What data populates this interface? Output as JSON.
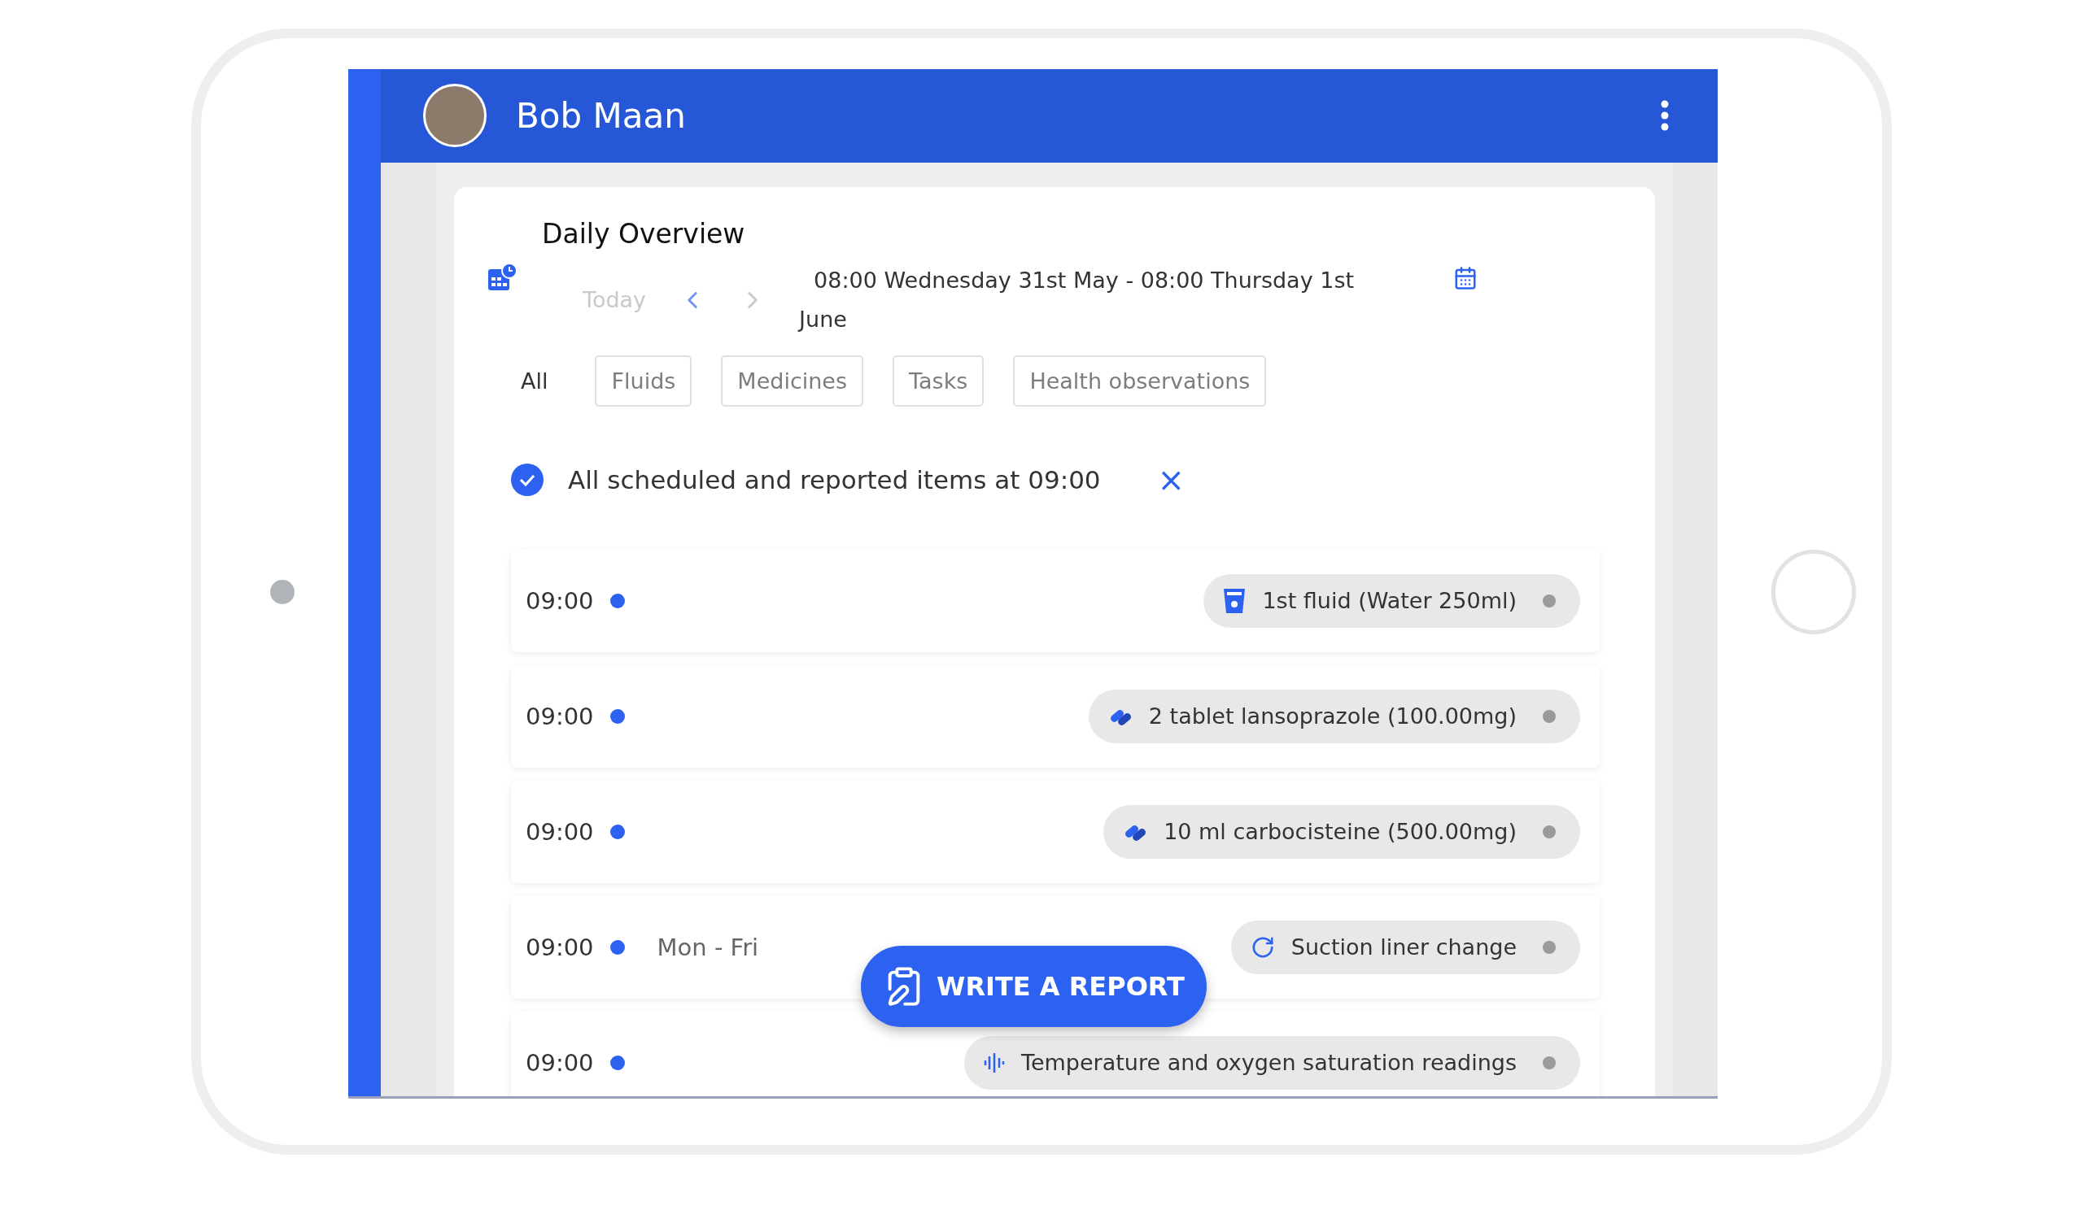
{
  "header": {
    "name": "Bob Maan"
  },
  "overview": {
    "title": "Daily Overview",
    "today": "Today",
    "range": "08:00 Wednesday 31st May - 08:00 Thursday 1st June"
  },
  "filters": [
    {
      "label": "All",
      "selected": true
    },
    {
      "label": "Fluids",
      "selected": false
    },
    {
      "label": "Medicines",
      "selected": false
    },
    {
      "label": "Tasks",
      "selected": false
    },
    {
      "label": "Health observations",
      "selected": false
    }
  ],
  "notice": {
    "text": "All scheduled and reported items at 09:00",
    "close": "×"
  },
  "items": [
    {
      "time": "09:00",
      "kind": "fluid",
      "label": "1st fluid (Water 250ml)"
    },
    {
      "time": "09:00",
      "kind": "medicine",
      "label": "2 tablet lansoprazole (100.00mg)"
    },
    {
      "time": "09:00",
      "kind": "medicine",
      "label": "10 ml carbocisteine (500.00mg)"
    },
    {
      "time": "09:00",
      "kind": "task",
      "repeat": "Mon - Fri",
      "label": "Suction liner change"
    },
    {
      "time": "09:00",
      "kind": "observation",
      "label": "Temperature and oxygen saturation readings"
    }
  ],
  "report_button": "WRITE A REPORT"
}
